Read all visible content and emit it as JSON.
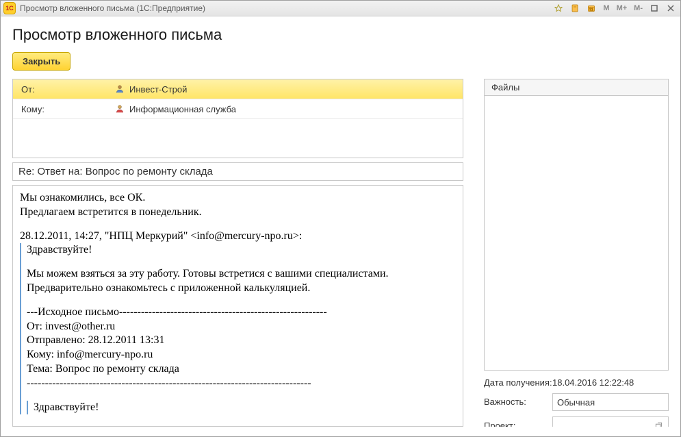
{
  "titlebar": {
    "text": "Просмотр вложенного письма  (1С:Предприятие)"
  },
  "page_title": "Просмотр вложенного письма",
  "close_button": "Закрыть",
  "headers": {
    "from_label": "От:",
    "from_value": "Инвест-Строй",
    "to_label": "Кому:",
    "to_value": "Информационная служба"
  },
  "subject": "Re: Ответ на: Вопрос по ремонту склада",
  "body": {
    "top1": "Мы ознакомились, все ОК.",
    "top2": "Предлагаем встретится в понедельник.",
    "quoted_intro": "28.12.2011, 14:27, \"НПЦ Меркурий\" <info@mercury-npo.ru>:",
    "q1_line1": "Здравствуйте!",
    "q1_line2": "Мы можем взяться за эту работу. Готовы встретися с вашими специалистами.",
    "q1_line3": "Предварительно ознакомьтесь с приложенной калькуляцией.",
    "sep_top": "---Исходное письмо---------------------------------------------------------",
    "orig_from": "От: invest@other.ru",
    "orig_sent": "Отправлено: 28.12.2011 13:31",
    "orig_to": "Кому: info@mercury-npo.ru",
    "orig_subject": "Тема: Вопрос по ремонту склада",
    "sep_bottom": "------------------------------------------------------------------------------",
    "q2_line1": "Здравствуйте!"
  },
  "files_panel": {
    "header": "Файлы"
  },
  "meta": {
    "received_label": "Дата получения:",
    "received_value": "18.04.2016 12:22:48",
    "importance_label": "Важность:",
    "importance_value": "Обычная",
    "project_label": "Проект:",
    "project_value": ""
  },
  "title_icons": {
    "m": "M",
    "mplus": "M+",
    "mminus": "M-"
  }
}
